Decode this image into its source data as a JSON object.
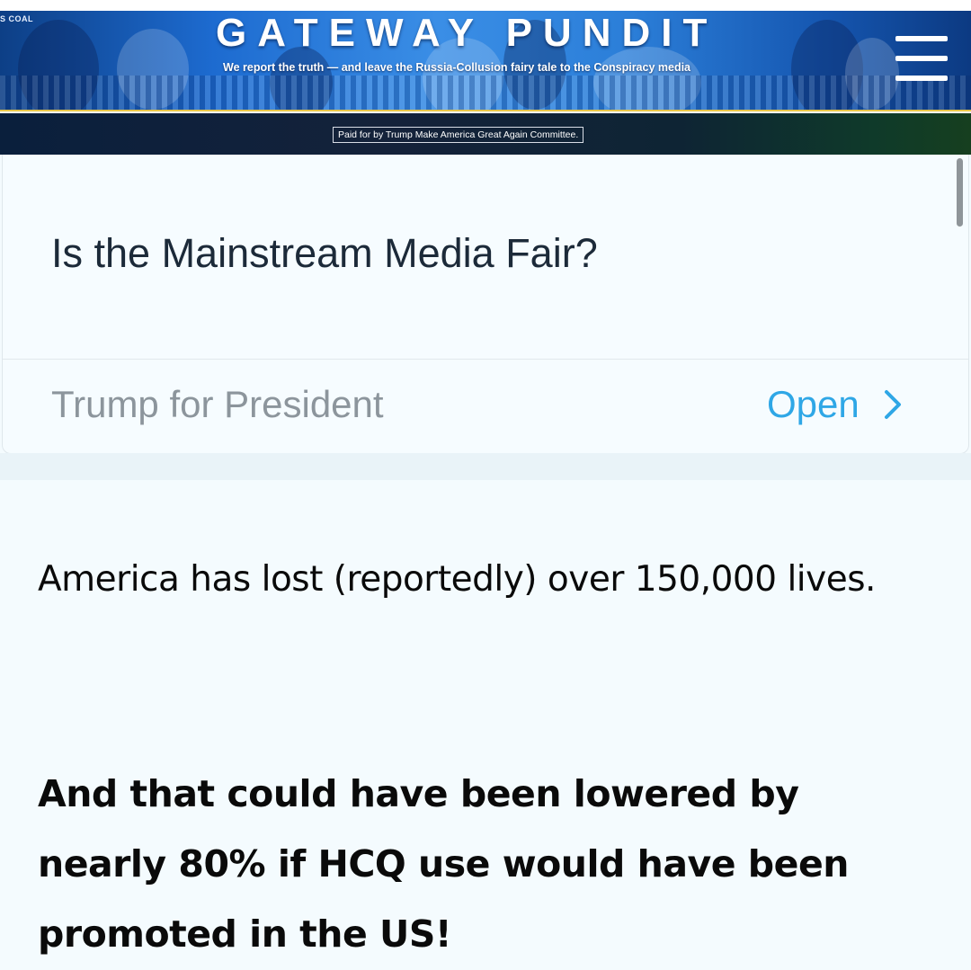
{
  "header": {
    "site_title": "GATEWAY PUNDIT",
    "tagline": "We report the truth — and leave the Russia-Collusion fairy tale to the Conspiracy media",
    "corner_tag": "S COAL",
    "menu_icon": "hamburger-menu-icon",
    "accent_rule_color": "#e8c64a"
  },
  "paid_strip": {
    "label": "Paid for by Trump Make America Great Again Committee."
  },
  "ad": {
    "headline": "Is the Mainstream Media Fair?",
    "advertiser": "Trump for President",
    "cta_label": "Open",
    "cta_icon": "chevron-right-icon",
    "cta_color": "#2fa7e6"
  },
  "article": {
    "paragraph_1": "America has lost (reportedly) over 150,000 lives.",
    "paragraph_2": "And that could have been lowered by nearly 80% if HCQ use would have been promoted in the US!"
  }
}
